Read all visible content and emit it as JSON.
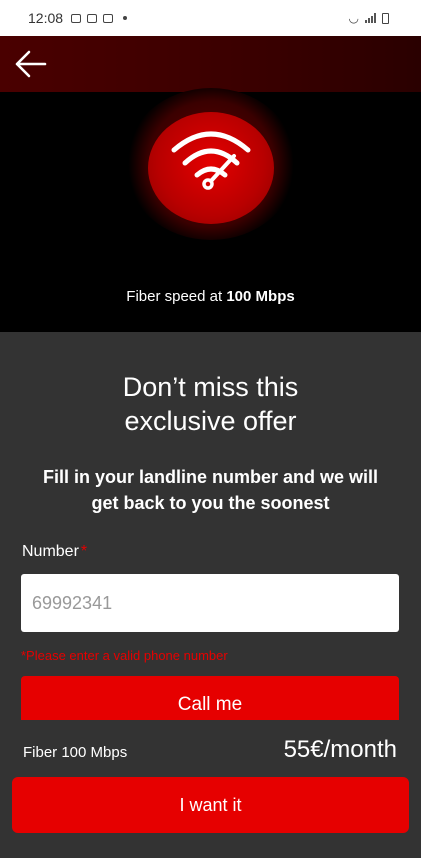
{
  "status_bar": {
    "time": "12:08"
  },
  "hero": {
    "caption_prefix": "Fiber speed at ",
    "caption_speed": "100 Mbps"
  },
  "form": {
    "title_line1": "Don’t miss this",
    "title_line2": "exclusive offer",
    "subtitle": "Fill in your landline number and we will get back to you the soonest",
    "number_label": "Number",
    "required_mark": "*",
    "number_placeholder": "69992341",
    "error_text": "*Please enter a valid phone number",
    "call_button": "Call me"
  },
  "offer": {
    "plan_name": "Fiber 100 Mbps",
    "price": "55€/month",
    "cta_button": "I want it"
  },
  "colors": {
    "accent": "#e60000",
    "panel": "#333333",
    "appbar": "#3a0000"
  },
  "icons": {
    "back": "arrow-left-icon",
    "hero": "wifi-speed-icon"
  }
}
